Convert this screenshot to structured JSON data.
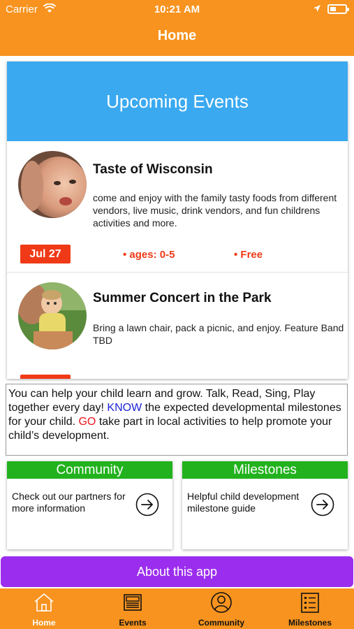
{
  "status_bar": {
    "carrier": "Carrier",
    "time": "10:21 AM"
  },
  "header": {
    "title": "Home"
  },
  "events": {
    "banner_title": "Upcoming Events",
    "items": [
      {
        "name": "Taste of Wisconsin",
        "description": "come and enjoy with the family tasty foods from different vendors, live music, drink vendors, and fun childrens activities and more.",
        "date": "Jul 27",
        "ages": "• ages: 0-5",
        "cost": "• Free"
      },
      {
        "name": "Summer Concert in the Park",
        "description": "Bring a lawn chair, pack a picnic, and enjoy.  Feature Band TBD",
        "date": "",
        "ages": "",
        "cost": ""
      }
    ]
  },
  "info": {
    "text_before_know": "You can help your child learn and grow. Talk, Read, Sing, Play together every day! ",
    "know": "KNOW",
    "text_after_know": " the expected developmental milestones for your child. ",
    "go": "GO",
    "text_after_go": " take part in local activities to help promote your child’s development."
  },
  "tiles": {
    "community": {
      "title": "Community",
      "text": "Check out our partners for more information"
    },
    "milestones": {
      "title": "Milestones",
      "text": "Helpful child development milestone guide"
    }
  },
  "about_button": "About this app",
  "tabs": [
    {
      "label": "Home",
      "icon": "home-icon",
      "active": true
    },
    {
      "label": "Events",
      "icon": "newspaper-icon",
      "active": false
    },
    {
      "label": "Community",
      "icon": "person-icon",
      "active": false
    },
    {
      "label": "Milestones",
      "icon": "checklist-icon",
      "active": false
    }
  ],
  "colors": {
    "header_orange": "#f7931e",
    "banner_blue": "#3aa9f0",
    "date_red": "#f03a17",
    "tile_green": "#21b21d",
    "about_purple": "#9b2dee"
  }
}
